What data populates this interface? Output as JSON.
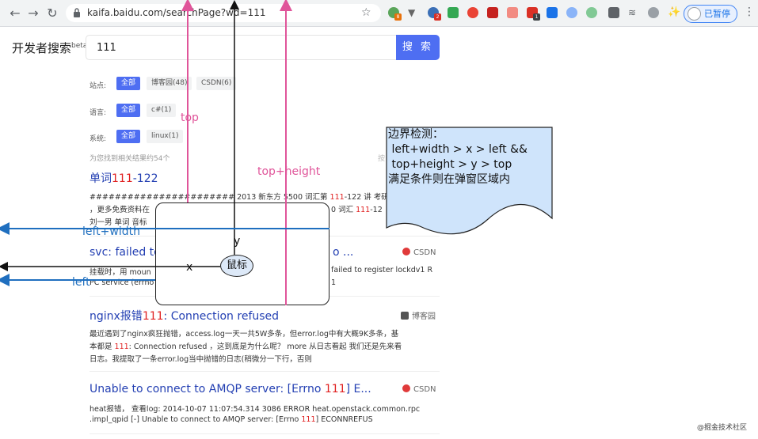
{
  "browser": {
    "url": "kaifa.baidu.com/searchPage?wd=111",
    "paused_label": "已暂停",
    "extension_badges": [
      "8",
      "2",
      "1"
    ]
  },
  "site": {
    "brand": "开发者搜索",
    "brand_sup": "beta",
    "search_value": "111",
    "search_button": "搜 索"
  },
  "filters": [
    {
      "label": "站点:",
      "options": [
        "全部",
        "博客园(48)",
        "CSDN(6)"
      ],
      "selected": 0
    },
    {
      "label": "语言:",
      "options": [
        "全部",
        "c#(1)"
      ],
      "selected": 0
    },
    {
      "label": "系统:",
      "options": [
        "全部",
        "linux(1)"
      ],
      "selected": 0
    }
  ],
  "result_count": "为您找到相关结果约54个",
  "sort_fragment": "按",
  "results": [
    {
      "title_pre": "单词",
      "title_hl": "111",
      "title_post": "-122",
      "line1_pre": "####################### 2013 新东方 5500 词汇第 ",
      "line1_hl": "111",
      "line1_post": "-122 讲 考研学子",
      "line2": "，更多免费资料在",
      "line2b_pre": "0 词汇 ",
      "line2b_hl": "111",
      "line2b_post": "-12",
      "line3": "刘一男 单词 音标"
    },
    {
      "title_pre": "svc: failed to",
      "title_hl": "",
      "title_post": "",
      "title_tail": "o ...",
      "source": "CSDN",
      "line1_pre": "挂载时，用 moun",
      "line1_hl": "",
      "line1_post": "",
      "line1_tail": "failed to register lockdv1 R",
      "line2": "PC service (errno",
      "line2_tail": "1"
    },
    {
      "title_pre": "nginx报错",
      "title_hl": "111",
      "title_post": ": Connection refused",
      "source": "博客园",
      "line1_pre": "最近遇到了nginx疯狂抛错，access.log一天一共5W多条，但error.log中有大概9K多条，基",
      "line2_pre": "本都是 ",
      "line2_hl": "111",
      "line2_post": ": Connection refused ，这到底是为什么呢？ more 从日志看起 我们还是先来看",
      "line3": "日志。我提取了一条error.log当中抛错的日志(稍微分一下行，否则"
    },
    {
      "title_pre": "Unable to connect to AMQP server: [Errno ",
      "title_hl": "111",
      "title_post": "] E...",
      "source": "CSDN",
      "line1_pre": "heat报错， 查看log: 2014-10-07 11:07:54.314 3086 ERROR heat.openstack.common.rpc",
      "line2_pre": ".impl_qpid [-] Unable to connect to AMQP server: [Errno ",
      "line2_hl": "111",
      "line2_post": "] ECONNREFUS"
    }
  ],
  "annotations": {
    "top": "top",
    "top_height": "top+height",
    "left_width": "left+width",
    "left": "left",
    "x": "x",
    "y": "y",
    "mouse": "鼠标",
    "note": "边界检测：\n left+width > x > left &&\n top+height > y > top\n满足条件则在弹窗区域内"
  },
  "watermark": "@掘金技术社区",
  "colors": {
    "accent": "#4e6ef2",
    "link": "#2440b3",
    "highlight": "#e02020",
    "arrow_pink": "#e0559a",
    "arrow_blue": "#1f6fbf",
    "note_fill": "#cfe4fb"
  }
}
